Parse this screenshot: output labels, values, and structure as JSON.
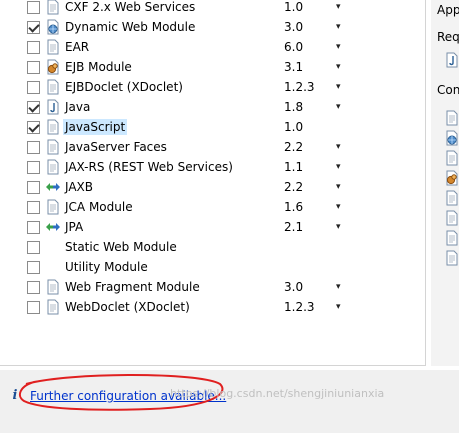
{
  "facets": [
    {
      "name": "CXF 2.x Web Services",
      "version": "1.0",
      "checked": false,
      "icon": "document-icon",
      "has_dropdown": true,
      "selected": false
    },
    {
      "name": "Dynamic Web Module",
      "version": "3.0",
      "checked": true,
      "icon": "web-module-icon",
      "has_dropdown": true,
      "selected": false
    },
    {
      "name": "EAR",
      "version": "6.0",
      "checked": false,
      "icon": "document-icon",
      "has_dropdown": true,
      "selected": false
    },
    {
      "name": "EJB Module",
      "version": "3.1",
      "checked": false,
      "icon": "ejb-icon",
      "has_dropdown": true,
      "selected": false
    },
    {
      "name": "EJBDoclet (XDoclet)",
      "version": "1.2.3",
      "checked": false,
      "icon": "document-icon",
      "has_dropdown": true,
      "selected": false
    },
    {
      "name": "Java",
      "version": "1.8",
      "checked": true,
      "icon": "java-icon",
      "has_dropdown": true,
      "selected": false
    },
    {
      "name": "JavaScript",
      "version": "1.0",
      "checked": true,
      "icon": "document-icon",
      "has_dropdown": false,
      "selected": true
    },
    {
      "name": "JavaServer Faces",
      "version": "2.2",
      "checked": false,
      "icon": "document-icon",
      "has_dropdown": true,
      "selected": false
    },
    {
      "name": "JAX-RS (REST Web Services)",
      "version": "1.1",
      "checked": false,
      "icon": "document-icon",
      "has_dropdown": true,
      "selected": false
    },
    {
      "name": "JAXB",
      "version": "2.2",
      "checked": false,
      "icon": "jaxb-arrows-icon",
      "has_dropdown": true,
      "selected": false
    },
    {
      "name": "JCA Module",
      "version": "1.6",
      "checked": false,
      "icon": "document-icon",
      "has_dropdown": true,
      "selected": false
    },
    {
      "name": "JPA",
      "version": "2.1",
      "checked": false,
      "icon": "jpa-arrows-icon",
      "has_dropdown": true,
      "selected": false
    },
    {
      "name": "Static Web Module",
      "version": "",
      "checked": false,
      "icon": "",
      "has_dropdown": false,
      "selected": false
    },
    {
      "name": "Utility Module",
      "version": "",
      "checked": false,
      "icon": "",
      "has_dropdown": false,
      "selected": false
    },
    {
      "name": "Web Fragment Module",
      "version": "3.0",
      "checked": false,
      "icon": "document-icon",
      "has_dropdown": true,
      "selected": false
    },
    {
      "name": "WebDoclet (XDoclet)",
      "version": "1.2.3",
      "checked": false,
      "icon": "document-icon",
      "has_dropdown": true,
      "selected": false
    }
  ],
  "dropdown_glyph": "▾",
  "side_panel": {
    "label_1": "App",
    "label_2": "Req",
    "label_3": "Con",
    "icons": [
      "java-icon",
      "document-icon",
      "web-module-icon",
      "document-icon",
      "ejb-icon",
      "document-icon",
      "document-icon",
      "document-icon",
      "document-icon"
    ]
  },
  "bottom": {
    "info_glyph": "i",
    "link_label": "Further configuration available...",
    "watermark": "https://blog.csdn.net/shengjiniunianxia"
  },
  "colors": {
    "link": "#0033cc",
    "selection": "#cce8ff",
    "annotation": "#e02020",
    "info_icon": "#1b4d94"
  }
}
